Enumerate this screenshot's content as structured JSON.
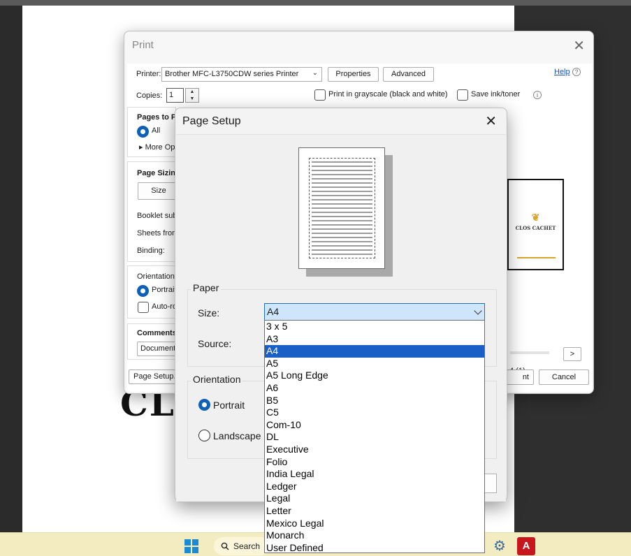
{
  "background": {
    "doc_big_text": "CL"
  },
  "taskbar": {
    "search_label": "Search",
    "search_icon": "search-icon",
    "start_icon": "windows-start-icon",
    "settings_icon": "gear-icon",
    "pdf_icon": "acrobat-icon"
  },
  "print_dialog": {
    "title": "Print",
    "printer_label": "Printer:",
    "printer_value": "Brother MFC-L3750CDW series Printer",
    "properties_label": "Properties",
    "advanced_label": "Advanced",
    "help_label": "Help",
    "copies_label": "Copies:",
    "copies_value": "1",
    "grayscale_label": "Print in grayscale (black and white)",
    "save_ink_label": "Save ink/toner",
    "pages_to_print_label": "Pages to Pri",
    "all_label": "All",
    "more_options_label": "More Op",
    "page_sizing_label": "Page Sizing",
    "size_tab_label": "Size",
    "booklet_label": "Booklet sub",
    "sheets_label": "Sheets from",
    "binding_label": "Binding:",
    "orientation_label": "Orientation:",
    "portrait_label": "Portrait",
    "auto_rotate_label": "Auto-ro",
    "comments_label": "Comments",
    "document_label": "Document",
    "page_setup_button": "Page Setup...",
    "print_button_partial": "nt",
    "cancel_button": "Cancel",
    "next_page_button": ">",
    "page_indicator": "4 (1)",
    "preview_brand": "CLOS CACHET"
  },
  "page_setup": {
    "title": "Page Setup",
    "paper_legend": "Paper",
    "size_label": "Size:",
    "size_value": "A4",
    "source_label": "Source:",
    "orientation_legend": "Orientation",
    "portrait_label": "Portrait",
    "landscape_label": "Landscape",
    "orientation_selected": "Portrait"
  },
  "size_dropdown": {
    "selected": "A4",
    "options": [
      "3 x 5",
      "A3",
      "A4",
      "A5",
      "A5 Long Edge",
      "A6",
      "B5",
      "C5",
      "Com-10",
      "DL",
      "Executive",
      "Folio",
      "India Legal",
      "Ledger",
      "Legal",
      "Letter",
      "Mexico Legal",
      "Monarch",
      "User Defined"
    ]
  },
  "colors": {
    "accent": "#1060b8",
    "dropdown_selection": "#1a5fc6",
    "select_highlight": "#cfe5fb",
    "taskbar": "#f3ecc0",
    "pdf_red": "#c8161d",
    "brand_gold": "#d9a42c"
  }
}
